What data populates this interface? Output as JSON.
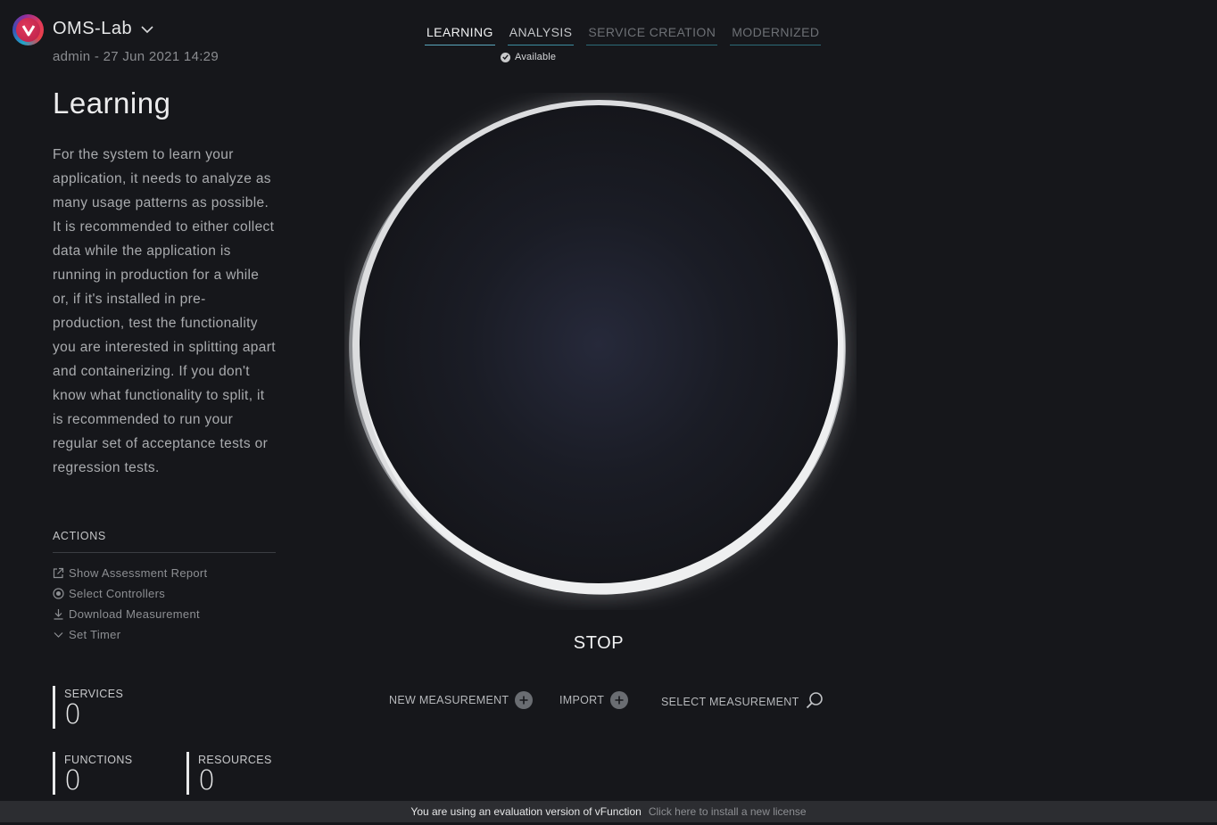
{
  "header": {
    "app_name": "OMS-Lab",
    "subline": "admin - 27 Jun 2021 14:29"
  },
  "tabs": [
    {
      "label": "LEARNING",
      "state": "active"
    },
    {
      "label": "ANALYSIS",
      "state": "enabled"
    },
    {
      "label": "SERVICE CREATION",
      "state": "disabled"
    },
    {
      "label": "MODERNIZED",
      "state": "disabled"
    }
  ],
  "status": {
    "label": "Available"
  },
  "sidebar": {
    "title": "Learning",
    "description": "For the system to learn your application, it needs to analyze as many usage patterns as possible. It is recommended to either collect data while the application is running in production for a while or, if it's installed in pre-production, test the functionality you are interested in splitting apart and containerizing. If you don't know what functionality to split, it is recommended to run your regular set of acceptance tests or regression tests.",
    "actions_title": "ACTIONS",
    "actions": [
      {
        "label": "Show Assessment Report",
        "icon": "external-link-icon"
      },
      {
        "label": "Select Controllers",
        "icon": "radio-target-icon"
      },
      {
        "label": "Download Measurement",
        "icon": "download-icon"
      },
      {
        "label": "Set Timer",
        "icon": "chevron-down-icon"
      }
    ]
  },
  "stats": {
    "services": {
      "label": "SERVICES",
      "value": "0"
    },
    "functions": {
      "label": "FUNCTIONS",
      "value": "0"
    },
    "resources": {
      "label": "RESOURCES",
      "value": "0"
    }
  },
  "main": {
    "stop_label": "STOP",
    "new_measurement": "NEW MEASUREMENT",
    "import": "IMPORT",
    "select_measurement": "SELECT MEASUREMENT"
  },
  "footer": {
    "message": "You are using an evaluation version of vFunction",
    "link": "Click here to install a new license"
  },
  "colors": {
    "background": "#16171b",
    "accent": "#5aa7bd",
    "brand": "#d42e55"
  }
}
